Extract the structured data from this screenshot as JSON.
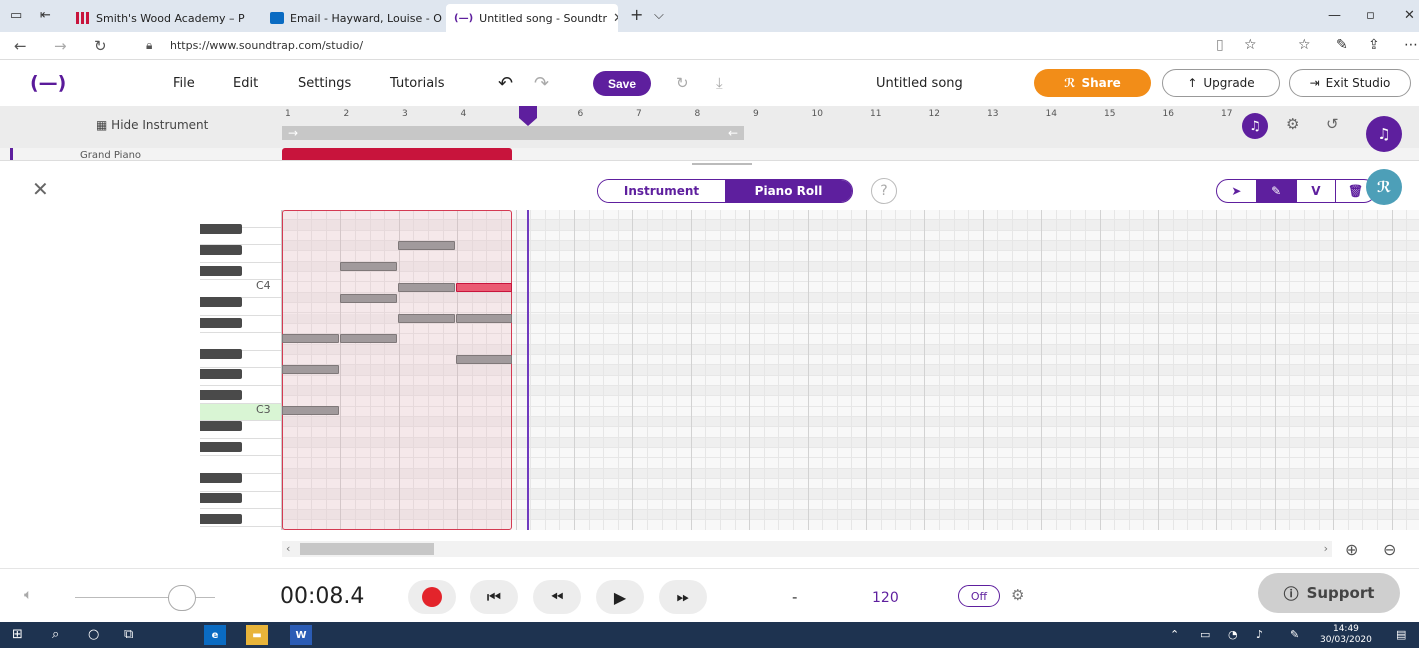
{
  "browser": {
    "tabs": [
      {
        "title": "Smith's Wood Academy – P",
        "fav_color": "#c8143c"
      },
      {
        "title": "Email - Hayward, Louise - O",
        "fav_color": "#0a6bc2"
      },
      {
        "title": "Untitled song - Soundtr",
        "fav_color": "#5e1f9e"
      }
    ],
    "url": "https://www.soundtrap.com/studio/",
    "new_tab": "+",
    "tab_menu": "⌵"
  },
  "app": {
    "logo": "(—)",
    "menu": [
      "File",
      "Edit",
      "Settings",
      "Tutorials"
    ],
    "save_label": "Save",
    "song_title": "Untitled song",
    "share_label": "Share",
    "upgrade_label": "Upgrade",
    "exit_label": "Exit Studio",
    "brand_color": "#5e1f9e",
    "share_color": "#f28d18"
  },
  "timeline": {
    "hide_instrument": "Hide Instrument",
    "bars": [
      "1",
      "2",
      "3",
      "4",
      "5",
      "6",
      "7",
      "8",
      "9",
      "10",
      "11",
      "12",
      "13",
      "14",
      "15",
      "16",
      "17"
    ],
    "track_name": "Grand Piano",
    "loop_start_arrow": "→",
    "loop_end_arrow": "←"
  },
  "editor": {
    "tab_instrument": "Instrument",
    "tab_piano_roll": "Piano Roll",
    "help": "?",
    "tool_velocity": "V",
    "key_labels": {
      "c4": "C4",
      "c3": "C3"
    }
  },
  "transport": {
    "time": "00:08.4",
    "key": "-",
    "tempo": "120",
    "metronome": "Off",
    "support_label": "Support"
  },
  "taskbar": {
    "time": "14:49",
    "date": "30/03/2020"
  }
}
